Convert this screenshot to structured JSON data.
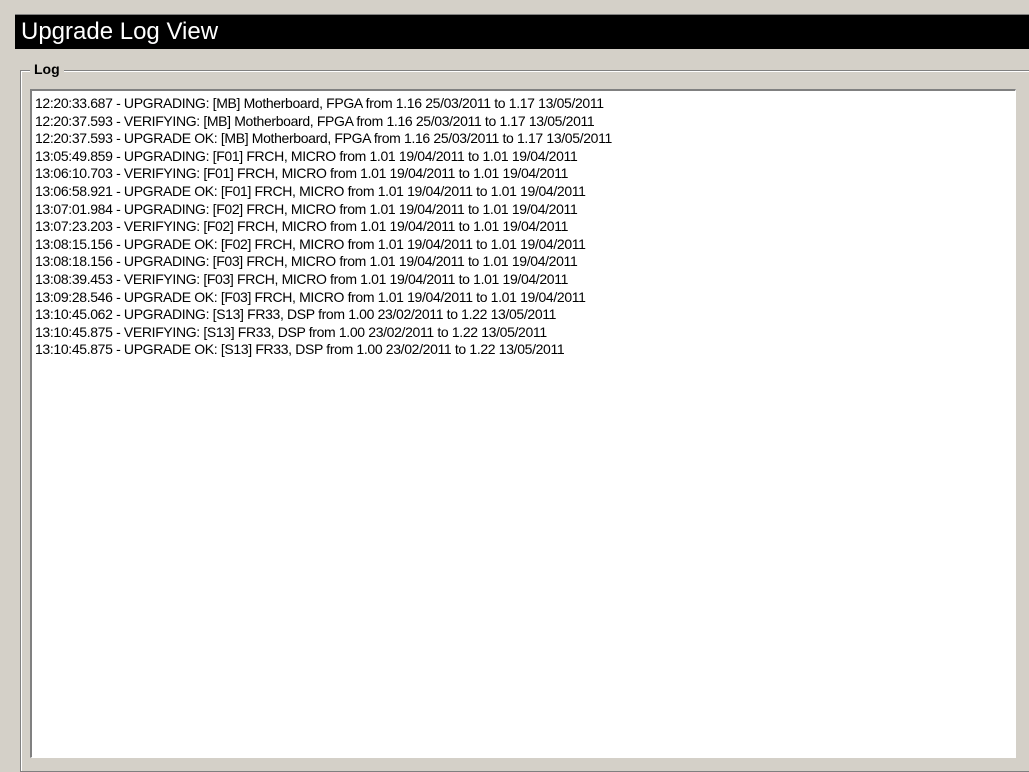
{
  "window": {
    "title": "Upgrade Log View"
  },
  "log_group": {
    "label": "Log"
  },
  "log": {
    "lines": [
      "12:20:33.687 - UPGRADING: [MB] Motherboard, FPGA from 1.16 25/03/2011 to 1.17 13/05/2011",
      "12:20:37.593 - VERIFYING: [MB] Motherboard, FPGA from 1.16 25/03/2011 to 1.17 13/05/2011",
      "12:20:37.593 - UPGRADE OK: [MB] Motherboard, FPGA from 1.16 25/03/2011 to 1.17 13/05/2011",
      "13:05:49.859 - UPGRADING: [F01] FRCH, MICRO from 1.01 19/04/2011 to 1.01 19/04/2011",
      "13:06:10.703 - VERIFYING: [F01] FRCH, MICRO from 1.01 19/04/2011 to 1.01 19/04/2011",
      "13:06:58.921 - UPGRADE OK: [F01] FRCH, MICRO from 1.01 19/04/2011 to 1.01 19/04/2011",
      "13:07:01.984 - UPGRADING: [F02] FRCH, MICRO from 1.01 19/04/2011 to 1.01 19/04/2011",
      "13:07:23.203 - VERIFYING: [F02] FRCH, MICRO from 1.01 19/04/2011 to 1.01 19/04/2011",
      "13:08:15.156 - UPGRADE OK: [F02] FRCH, MICRO from 1.01 19/04/2011 to 1.01 19/04/2011",
      "13:08:18.156 - UPGRADING: [F03] FRCH, MICRO from 1.01 19/04/2011 to 1.01 19/04/2011",
      "13:08:39.453 - VERIFYING: [F03] FRCH, MICRO from 1.01 19/04/2011 to 1.01 19/04/2011",
      "13:09:28.546 - UPGRADE OK: [F03] FRCH, MICRO from 1.01 19/04/2011 to 1.01 19/04/2011",
      "13:10:45.062 - UPGRADING: [S13] FR33, DSP from 1.00 23/02/2011 to 1.22 13/05/2011",
      "13:10:45.875 - VERIFYING: [S13] FR33, DSP from 1.00 23/02/2011 to 1.22 13/05/2011",
      "13:10:45.875 - UPGRADE OK: [S13] FR33, DSP from 1.00 23/02/2011 to 1.22 13/05/2011"
    ]
  },
  "colors": {
    "window_background": "#d4d0c8",
    "title_background": "#000000",
    "title_text": "#ffffff",
    "log_background": "#ffffff",
    "log_text": "#000000"
  }
}
